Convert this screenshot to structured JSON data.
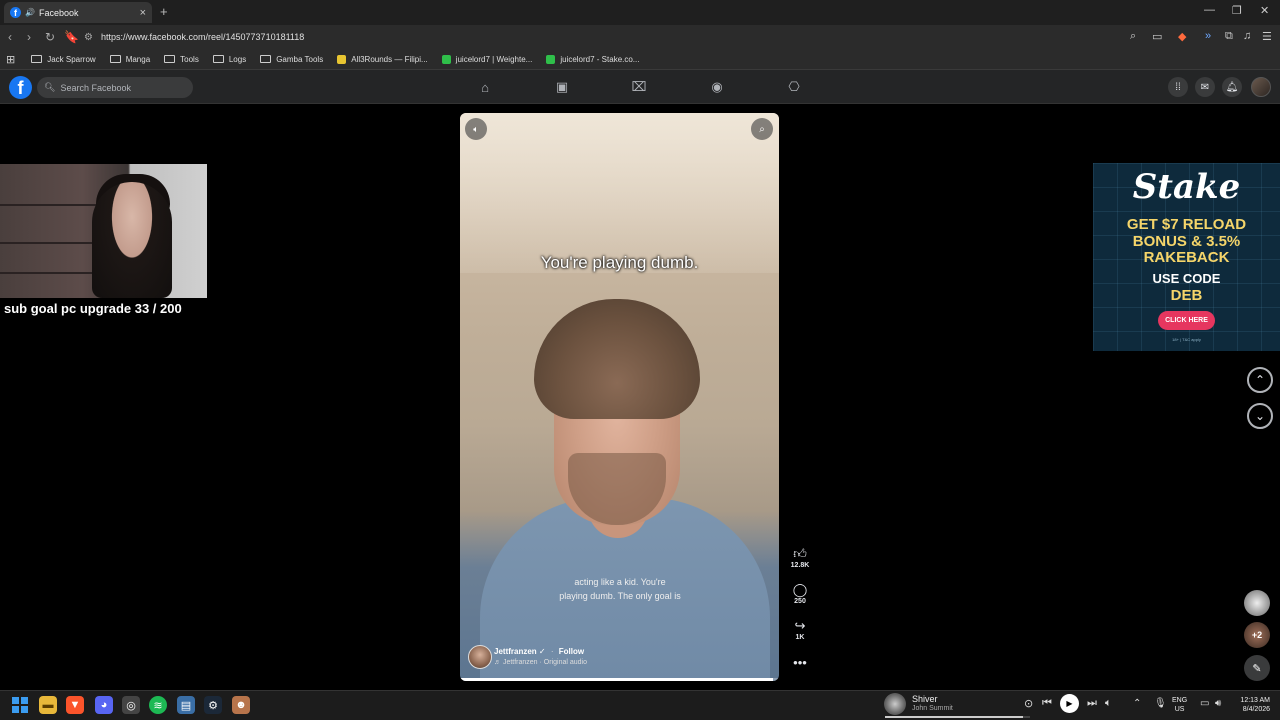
{
  "browser": {
    "tab_title": "Facebook",
    "new_tab_glyph": "+",
    "url": "https://www.facebook.com/reel/1450773710181118",
    "bookmarks": [
      {
        "label": "Jack Sparrow",
        "icon": "folder-icon"
      },
      {
        "label": "Manga",
        "icon": "folder-icon"
      },
      {
        "label": "Tools",
        "icon": "folder-icon"
      },
      {
        "label": "Logs",
        "icon": "folder-icon"
      },
      {
        "label": "Gamba Tools",
        "icon": "folder-icon"
      },
      {
        "label": "All3Rounds — Filipi...",
        "icon": "site-icon",
        "color": "#e8c531"
      },
      {
        "label": "juicelord7 | Weighte...",
        "icon": "site-icon",
        "color": "#2fbf4a"
      },
      {
        "label": "juicelord7 - Stake.co...",
        "icon": "site-icon",
        "color": "#2fbf4a"
      }
    ]
  },
  "facebook": {
    "logo_letter": "f",
    "search_placeholder": "Search Facebook",
    "nav_icons": [
      "home-icon",
      "reels-icon",
      "marketplace-icon",
      "groups-icon",
      "gaming-icon"
    ],
    "right_icons": [
      "menu-grid-icon",
      "messenger-icon",
      "notifications-icon",
      "profile-avatar"
    ]
  },
  "stream_overlay": {
    "sub_goal_text": "sub goal pc upgrade 33 / 200"
  },
  "reel": {
    "caption": "You're playing dumb.",
    "subtitle_line1": "acting like a kid. You're",
    "subtitle_line2": "playing dumb. The only goal is",
    "author": "Jettfranzen",
    "verified_glyph": "✓",
    "follow_label": "Follow",
    "audio": "♬ Jettfranzen · Original audio",
    "progress_fraction": 0.98,
    "actions": {
      "like_count": "12.8K",
      "comment_count": "250",
      "share_count": "1K"
    }
  },
  "ad": {
    "brand": "Stake",
    "line1": "GET $7 RELOAD",
    "line2": "BONUS & 3.5%",
    "line3": "RAKEBACK",
    "code_label": "USE CODE",
    "code": "DEB",
    "cta": "CLICK HERE",
    "fine_print": "18+ | T&C apply",
    "accent": "#f5d56a"
  },
  "side": {
    "badge_count": "+2"
  },
  "taskbar": {
    "media_title": "Shiver",
    "media_artist": "John Summit",
    "media_progress_fraction": 0.95,
    "lang_line1": "ENG",
    "lang_line2": "US",
    "time": "12:13 AM",
    "date": "8/4/2026"
  }
}
